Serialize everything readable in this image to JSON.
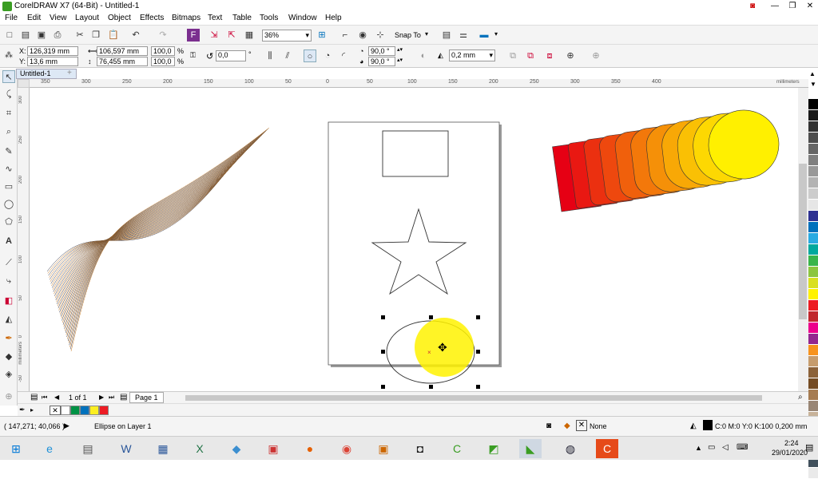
{
  "window": {
    "title": "CorelDRAW X7 (64-Bit) - Untitled-1"
  },
  "menu": [
    "File",
    "Edit",
    "View",
    "Layout",
    "Object",
    "Effects",
    "Bitmaps",
    "Text",
    "Table",
    "Tools",
    "Window",
    "Help"
  ],
  "toolbar": {
    "zoom": "36%",
    "snap_to": "Snap To"
  },
  "propertybar": {
    "x_label": "X:",
    "x": "126,319 mm",
    "y_label": "Y:",
    "y": "13,6 mm",
    "w": "106,597 mm",
    "h": "76,455 mm",
    "sx": "100,0",
    "sy": "100,0",
    "pct": "%",
    "rotation": "0,0",
    "deg": "°",
    "start_angle": "90,0 °",
    "end_angle": "90,0 °",
    "outline_width": "0,2 mm"
  },
  "document": {
    "tab": "Untitled-1"
  },
  "ruler": {
    "units": "millimeters",
    "h_ticks": [
      "350",
      "300",
      "250",
      "200",
      "150",
      "100",
      "50",
      "0",
      "50",
      "100",
      "150",
      "200",
      "250",
      "300",
      "350",
      "400"
    ],
    "v_ticks": [
      "300",
      "250",
      "200",
      "150",
      "100",
      "50",
      "0",
      "-50"
    ],
    "v_units": "millimeters"
  },
  "pagebar": {
    "page_of": "1 of 1",
    "page_name": "Page 1"
  },
  "status": {
    "coords": "( 147,271; 40,066 )",
    "object": "Ellipse on Layer 1",
    "fill": "None",
    "outline": "C:0 M:0 Y:0 K:100  0,200 mm"
  },
  "clock": {
    "time": "2:24",
    "date": "29/01/2020"
  },
  "colors": {
    "palette": [
      "#ffffff",
      "#000000",
      "#1a1a1a",
      "#333333",
      "#4d4d4d",
      "#666666",
      "#808080",
      "#999999",
      "#b3b3b3",
      "#cccccc",
      "#e6e6e6",
      "#2e3192",
      "#0071bc",
      "#29abe2",
      "#00a99d",
      "#39b54a",
      "#8cc63f",
      "#d9e021",
      "#fff200",
      "#ed1c24",
      "#c1272d",
      "#ec008c",
      "#93278f",
      "#f7931e",
      "#c69c6d",
      "#8c6239",
      "#754c24",
      "#a67c52",
      "#998675",
      "#c7b299",
      "#bdccd4",
      "#8da6b5",
      "#5f7d8e",
      "#41505c",
      "#eaeaea"
    ],
    "doc_palette": [
      "#ffffff",
      "#009245",
      "#0071bc",
      "#fcee21",
      "#ed1c24"
    ],
    "selection": "#fff200",
    "accent": "#3a9d23"
  },
  "icons": {
    "new": "□",
    "open": "▤",
    "save": "▣",
    "print": "⎙",
    "cut": "✂",
    "copy": "❐",
    "paste": "📋",
    "undo": "↶",
    "redo": "↷",
    "pointer": "↖",
    "shape": "⤹",
    "crop": "⌗",
    "zoom": "⌕",
    "freehand": "✎",
    "rect": "▭",
    "ellipse": "◯",
    "polygon": "⬠",
    "text": "A",
    "line": "⟋",
    "fill": "◆",
    "eyedrop": "✒",
    "move": "✥",
    "lock": "🔒"
  }
}
